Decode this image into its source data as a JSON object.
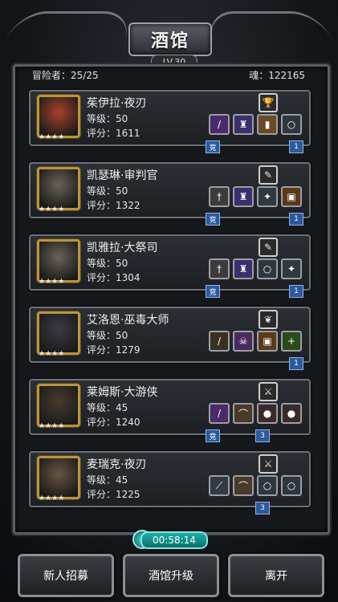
{
  "header": {
    "title": "酒馆",
    "level": "LV.30"
  },
  "stats": {
    "adventurers": "冒险者：25/25",
    "souls": "魂：122165"
  },
  "heroes": [
    {
      "name": "茱伊拉·夜刃",
      "level": "等级：50",
      "score": "评分：1611",
      "class_icon": "trophy-icon",
      "slots": [
        "blade-icon",
        "potion-icon",
        "bottle-icon",
        "ring-icon"
      ],
      "tags": [
        "竞",
        "1"
      ],
      "portrait": "#a8432c"
    },
    {
      "name": "凯瑟琳·审判官",
      "level": "等级：50",
      "score": "评分：1322",
      "class_icon": "feather-icon",
      "slots": [
        "mace-icon",
        "potion-icon",
        "scroll-icon",
        "barrel-icon"
      ],
      "tags": [
        "竞",
        "1"
      ],
      "portrait": "#6b6254"
    },
    {
      "name": "凯雅拉·大祭司",
      "level": "等级：50",
      "score": "评分：1304",
      "class_icon": "feather-icon",
      "slots": [
        "mace-icon",
        "potion-icon",
        "ring-icon",
        "scroll-icon"
      ],
      "tags": [
        "竞",
        "1"
      ],
      "portrait": "#6a6358"
    },
    {
      "name": "艾洛恩·巫毒大师",
      "level": "等级：50",
      "score": "评分：1279",
      "class_icon": "bird-icon",
      "slots": [
        "staff-icon",
        "skull-icon",
        "barrel-icon",
        "plus-icon"
      ],
      "tags": [
        "",
        "1"
      ],
      "portrait": "#3b3b45"
    },
    {
      "name": "莱姆斯·大游侠",
      "level": "等级：45",
      "score": "评分：1240",
      "class_icon": "crossbow-icon",
      "slots": [
        "blade-icon",
        "bow-icon",
        "ball-icon",
        "ball-icon"
      ],
      "tags": [
        "竞",
        "3"
      ],
      "portrait": "#4a3b2e"
    },
    {
      "name": "麦瑞克·夜刃",
      "level": "等级：45",
      "score": "评分：1225",
      "class_icon": "crossbow-icon",
      "slots": [
        "knife-icon",
        "bow-icon",
        "ring-icon",
        "ring-icon"
      ],
      "tags": [
        "",
        "3"
      ],
      "portrait": "#6b5440"
    }
  ],
  "stars": "★★★★",
  "timer": "00:58:14",
  "buttons": {
    "recruit": "新人招募",
    "upgrade": "酒馆升级",
    "leave": "离开"
  }
}
